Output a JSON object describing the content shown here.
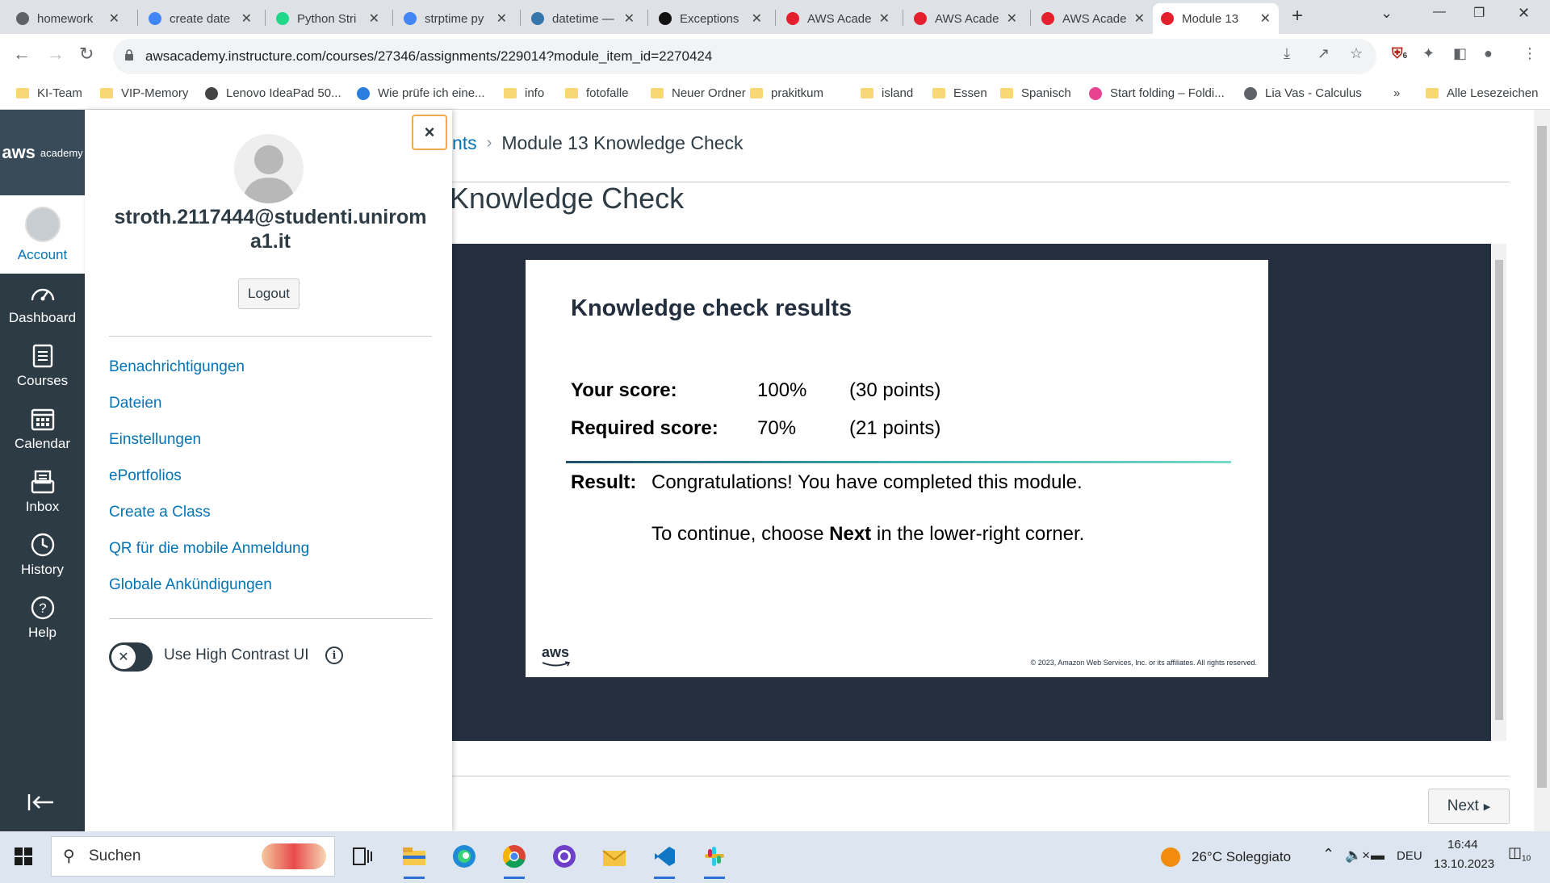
{
  "browser": {
    "tabs": [
      {
        "title": "homework",
        "icon": "globe-icon",
        "color": "#5f6368"
      },
      {
        "title": "create date",
        "icon": "google-icon",
        "color": "#4285f4"
      },
      {
        "title": "Python Stri",
        "icon": "pycharm-icon",
        "color": "#21d789"
      },
      {
        "title": "strptime py",
        "icon": "google-icon",
        "color": "#4285f4"
      },
      {
        "title": "datetime —",
        "icon": "python-icon",
        "color": "#3776ab"
      },
      {
        "title": "Exceptions",
        "icon": "programiz-icon",
        "color": "#111111"
      },
      {
        "title": "AWS Acade",
        "icon": "canvas-icon",
        "color": "#e4202e"
      },
      {
        "title": "AWS Acade",
        "icon": "canvas-icon",
        "color": "#e4202e"
      },
      {
        "title": "AWS Acade",
        "icon": "canvas-icon",
        "color": "#e4202e"
      },
      {
        "title": "Module 13",
        "icon": "canvas-icon",
        "color": "#e4202e"
      }
    ],
    "url": "awsacademy.instructure.com/courses/27346/assignments/229014?module_item_id=2270424",
    "extension_badge": "6",
    "bookmarks": [
      {
        "label": "KI-Team",
        "type": "folder"
      },
      {
        "label": "VIP-Memory",
        "type": "folder"
      },
      {
        "label": "Lenovo IdeaPad 50...",
        "type": "site",
        "icon": "lenovo-icon"
      },
      {
        "label": "Wie prüfe ich eine...",
        "type": "site",
        "icon": "droplet-icon"
      },
      {
        "label": "info",
        "type": "folder"
      },
      {
        "label": "fotofalle",
        "type": "folder"
      },
      {
        "label": "Neuer Ordner",
        "type": "folder"
      },
      {
        "label": "prakitkum",
        "type": "folder"
      },
      {
        "label": "island",
        "type": "folder"
      },
      {
        "label": "Essen",
        "type": "folder"
      },
      {
        "label": "Spanisch",
        "type": "folder"
      },
      {
        "label": "Start folding – Foldi...",
        "type": "site",
        "icon": "foldit-icon"
      },
      {
        "label": "Lia Vas - Calculus",
        "type": "site",
        "icon": "globe-icon"
      }
    ],
    "overflow": "»",
    "all_bookmarks": "Alle Lesezeichen"
  },
  "nav": {
    "logo_big": "aws",
    "logo_small": "academy",
    "account": "Account",
    "items": [
      {
        "label": "Dashboard",
        "icon": "dashboard-icon"
      },
      {
        "label": "Courses",
        "icon": "courses-icon"
      },
      {
        "label": "Calendar",
        "icon": "calendar-icon"
      },
      {
        "label": "Inbox",
        "icon": "inbox-icon"
      },
      {
        "label": "History",
        "icon": "history-icon"
      },
      {
        "label": "Help",
        "icon": "help-icon"
      }
    ]
  },
  "tray": {
    "close": "×",
    "email": "stroth.2117444@studenti.uniroma1.it",
    "logout": "Logout",
    "links": [
      "Benachrichtigungen",
      "Dateien",
      "Einstellungen",
      "ePortfolios",
      "Create a Class",
      "QR für die mobile Anmeldung",
      "Globale Ankündigungen"
    ],
    "contrast_label": "Use High Contrast UI",
    "contrast_on": false
  },
  "main": {
    "breadcrumb_partial": "nts",
    "breadcrumb_current": "Module 13 Knowledge Check",
    "title_partial": "Knowledge Check",
    "next": "Next"
  },
  "card": {
    "heading": "Knowledge check results",
    "your_score_label": "Your score:",
    "your_score_pct": "100%",
    "your_score_pts": "(30 points)",
    "required_label": "Required score:",
    "required_pct": "70%",
    "required_pts": "(21 points)",
    "result_label": "Result:",
    "result_text": "Congratulations! You have completed this module.",
    "continue_pre": "To continue, choose ",
    "continue_bold": "Next",
    "continue_post": " in the lower-right corner.",
    "logo": "aws",
    "copyright": "© 2023, Amazon Web Services, Inc. or its affiliates. All rights reserved."
  },
  "taskbar": {
    "search": "Suchen",
    "weather": "26°C  Soleggiato",
    "lang": "DEU",
    "time": "16:44",
    "date": "13.10.2023",
    "notif_count": "10"
  }
}
